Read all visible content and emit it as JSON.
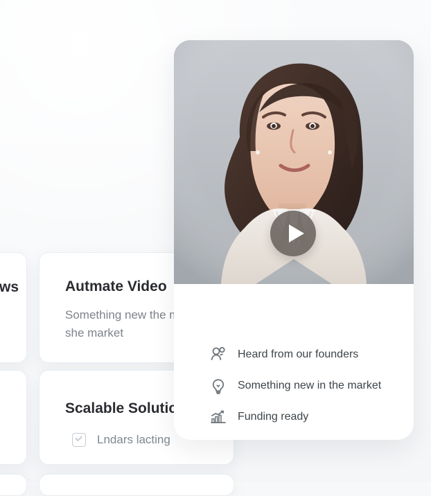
{
  "background_cards": {
    "left_top_fragment": "ws",
    "main_top": {
      "title": "Autmate Video",
      "description": "Something new the market she market"
    },
    "main_bottom": {
      "title": "Scalable Solutic",
      "item_label": "Lndars lacting"
    }
  },
  "profile_card": {
    "items": [
      {
        "icon": "people-icon",
        "label": "Heard from our founders"
      },
      {
        "icon": "lightbulb-icon",
        "label": "Something new in the market"
      },
      {
        "icon": "growth-chart-icon",
        "label": "Funding ready"
      }
    ]
  },
  "colors": {
    "background": "#f7f8f9",
    "card": "#ffffff",
    "text_primary": "#2a2c30",
    "text_secondary": "#7d838b",
    "icon_gray": "#6f767d",
    "play_button": "#59514c"
  }
}
